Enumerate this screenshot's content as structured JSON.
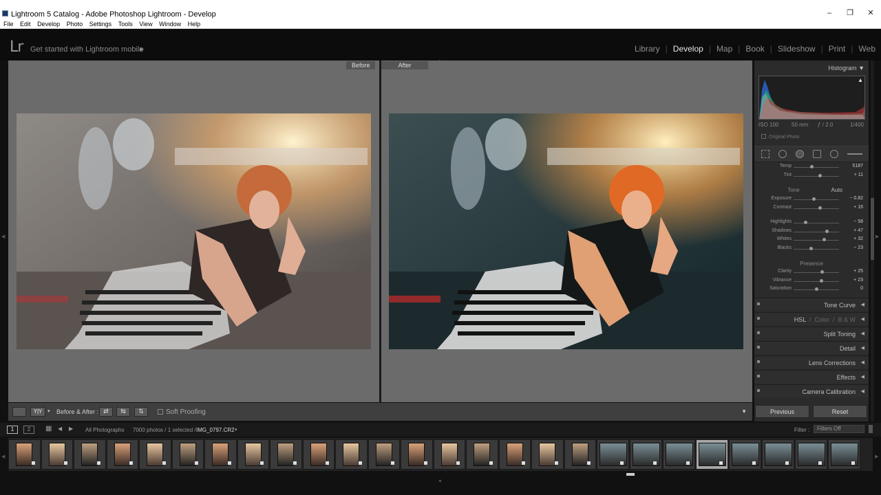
{
  "window": {
    "title": "Lightroom 5 Catalog - Adobe Photoshop Lightroom - Develop",
    "minimize": "–",
    "maximize": "❐",
    "close": "✕"
  },
  "menu": [
    "File",
    "Edit",
    "Develop",
    "Photo",
    "Settings",
    "Tools",
    "View",
    "Window",
    "Help"
  ],
  "identity": {
    "logo": "Lr",
    "text": "Get started with Lightroom mobile",
    "arrow": "▶"
  },
  "modules": {
    "library": "Library",
    "develop": "Develop",
    "map": "Map",
    "book": "Book",
    "slideshow": "Slideshow",
    "print": "Print",
    "web": "Web",
    "sep": "|"
  },
  "viewer": {
    "before_label": "Before",
    "after_label": "After"
  },
  "toolbar": {
    "before_after": "Before & After :",
    "soft_proofing": "Soft Proofing",
    "yy": "Y|Y"
  },
  "panel": {
    "histogram_title": "Histogram",
    "iso": "ISO 100",
    "focal": "50 mm",
    "aperture": "ƒ / 2.0",
    "shutter": "1/400",
    "original_photo": "Original Photo",
    "basic_rows": [
      {
        "name": "Temp",
        "value": "5187",
        "pos": 0.4
      },
      {
        "name": "Tint",
        "value": "+ 11",
        "pos": 0.58
      }
    ],
    "tone_label": "Tone",
    "auto_label": "Auto",
    "tone_rows": [
      {
        "name": "Exposure",
        "value": "− 0.82",
        "pos": 0.44
      },
      {
        "name": "Contrast",
        "value": "+ 16",
        "pos": 0.58
      }
    ],
    "tone_rows2": [
      {
        "name": "Highlights",
        "value": "− 58",
        "pos": 0.25
      },
      {
        "name": "Shadows",
        "value": "+ 47",
        "pos": 0.73
      },
      {
        "name": "Whites",
        "value": "+ 32",
        "pos": 0.66
      },
      {
        "name": "Blacks",
        "value": "− 23",
        "pos": 0.38
      }
    ],
    "presence_label": "Presence",
    "presence_rows": [
      {
        "name": "Clarity",
        "value": "+ 25",
        "pos": 0.62
      },
      {
        "name": "Vibrance",
        "value": "+ 23",
        "pos": 0.61
      },
      {
        "name": "Saturation",
        "value": "0",
        "pos": 0.5
      }
    ],
    "sections": {
      "tone_curve": "Tone Curve",
      "hsl": "HSL",
      "color": "Color",
      "bw": "B & W",
      "slash": "/",
      "split_toning": "Split Toning",
      "detail": "Detail",
      "lens": "Lens Corrections",
      "effects": "Effects",
      "calibration": "Camera Calibration"
    },
    "previous": "Previous",
    "reset": "Reset"
  },
  "filmbar": {
    "screen1": "1",
    "screen2": "2",
    "source": "All Photographs",
    "info": "7000 photos / 1 selected /",
    "filename": "IMG_0797.CR2",
    "filter_label": "Filter :",
    "filter_value": "Filters Off"
  },
  "colors": {
    "accent": "#e8e8e8",
    "panel_bg": "#2b2b2b"
  }
}
